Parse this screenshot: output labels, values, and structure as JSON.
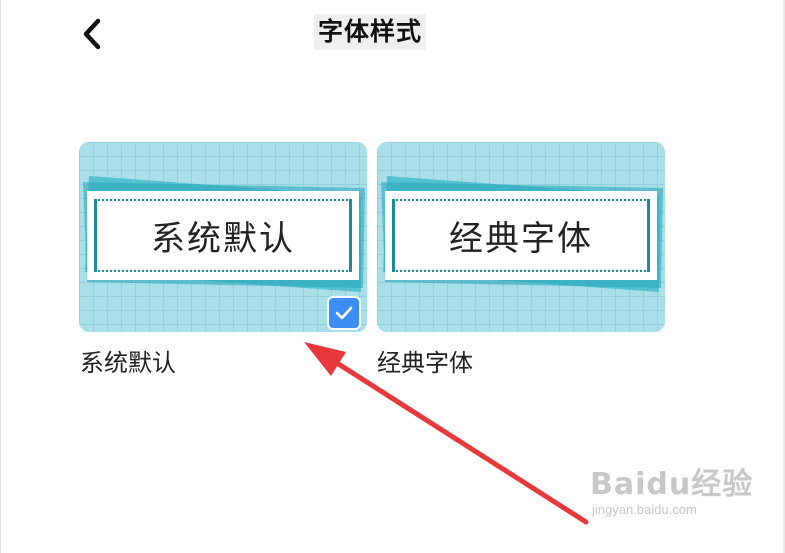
{
  "header": {
    "title": "字体样式",
    "back_icon": "chevron-left-icon"
  },
  "font_styles": [
    {
      "preview_text": "系统默认",
      "label": "系统默认",
      "selected": true
    },
    {
      "preview_text": "经典字体",
      "label": "经典字体",
      "selected": false
    }
  ],
  "colors": {
    "card_bg": "#a9dfe9",
    "accent_teal": "#1d8a98",
    "check_blue": "#3a8ef6",
    "arrow_red": "#e8383b"
  },
  "watermark": {
    "brand": "Baidu经验",
    "url": "jingyan.baidu.com"
  }
}
